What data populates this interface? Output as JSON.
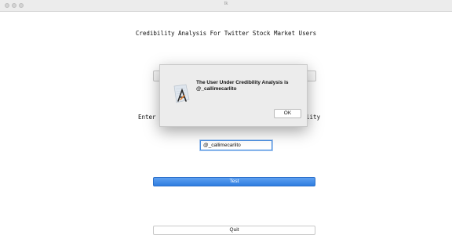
{
  "window": {
    "title": "tk",
    "controls": [
      "close-icon",
      "minimize-icon",
      "zoom-icon"
    ]
  },
  "main": {
    "heading": "Credibility Analysis For Twitter Stock Market Users",
    "enter_label": "Enter",
    "bility_label": "bility",
    "username_value": "@_callimecarlito",
    "test_label": "Test",
    "quit_label": "Quit"
  },
  "dialog": {
    "message_line1": "The User Under Credibility Analysis is",
    "message_line2": "@_callimecarlito",
    "ok_label": "OK",
    "icon": "app-icon"
  },
  "colors": {
    "accent": "#2f7de0",
    "dialog_bg": "#ececec"
  }
}
